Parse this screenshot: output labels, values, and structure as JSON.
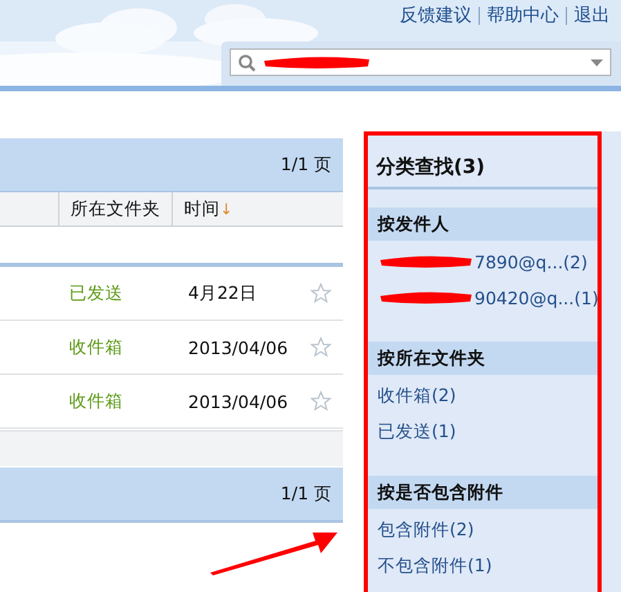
{
  "top_links": [
    "反馈建议",
    "帮助中心",
    "退出"
  ],
  "search": {
    "redacted": true
  },
  "list": {
    "pager_top": "1/1 页",
    "columns": [
      {
        "label": "所在文件夹"
      },
      {
        "label": "时间",
        "sort_mark": "↓"
      }
    ],
    "rows": [
      {
        "folder": "已发送",
        "time": "4月22日",
        "starred": false
      },
      {
        "folder": "收件箱",
        "time": "2013/04/06",
        "starred": false
      },
      {
        "folder": "收件箱",
        "time": "2013/04/06",
        "starred": false
      }
    ],
    "pager_bottom": "1/1 页"
  },
  "sidebar": {
    "title": "分类查找(3)",
    "sections": [
      {
        "title": "按发件人",
        "items": [
          {
            "text": "7890@q...(2)",
            "redacted": true
          },
          {
            "text": "90420@q...(1)",
            "redacted": true
          }
        ]
      },
      {
        "title": "按所在文件夹",
        "items": [
          {
            "text": "收件箱(2)",
            "redacted": false
          },
          {
            "text": "已发送(1)",
            "redacted": false
          }
        ]
      },
      {
        "title": "按是否包含附件",
        "items": [
          {
            "text": "包含附件(2)",
            "redacted": false
          },
          {
            "text": "不包含附件(1)",
            "redacted": false
          }
        ]
      }
    ]
  }
}
